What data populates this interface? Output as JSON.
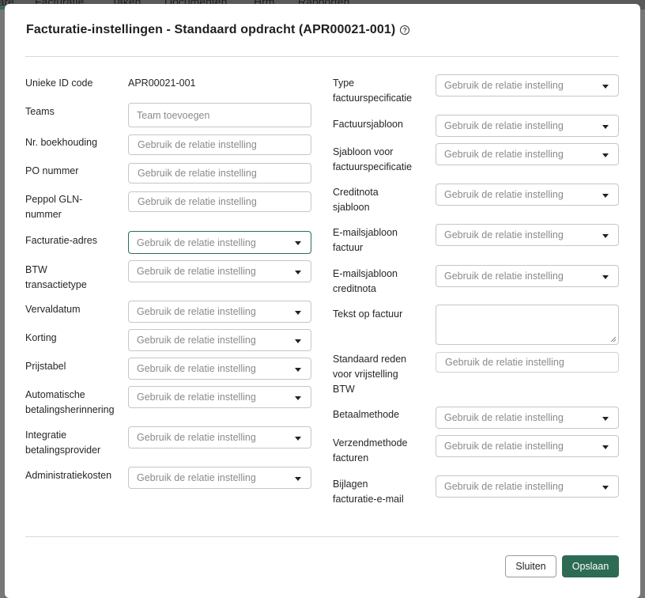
{
  "background": {
    "nav_items": [
      "...are",
      "Facturatie",
      "Taken",
      "Documenten",
      "Hrm",
      "Rapporten"
    ]
  },
  "modal": {
    "title": "Facturatie-instellingen - Standaard opdracht (APR00021-001)",
    "help_icon": "help-circle-icon"
  },
  "left": {
    "unique_id": {
      "label": "Unieke ID code",
      "value": "APR00021-001"
    },
    "teams": {
      "label": "Teams",
      "placeholder": "Team toevoegen"
    },
    "accounting_nr": {
      "label": "Nr. boekhouding",
      "placeholder": "Gebruik de relatie instelling"
    },
    "po_number": {
      "label": "PO nummer",
      "placeholder": "Gebruik de relatie instelling"
    },
    "peppol": {
      "label1": "Peppol GLN-",
      "label2": "nummer",
      "placeholder": "Gebruik de relatie instelling"
    },
    "invoice_address": {
      "label": "Facturatie-adres",
      "value": "Gebruik de relatie instelling"
    },
    "vat_type": {
      "label1": "BTW",
      "label2": "transactietype",
      "value": "Gebruik de relatie instelling"
    },
    "due_date": {
      "label": "Vervaldatum",
      "value": "Gebruik de relatie instelling"
    },
    "discount": {
      "label": "Korting",
      "value": "Gebruik de relatie instelling"
    },
    "price_table": {
      "label": "Prijstabel",
      "value": "Gebruik de relatie instelling"
    },
    "auto_reminder": {
      "label1": "Automatische",
      "label2": "betalingsherinnering",
      "value": "Gebruik de relatie instelling"
    },
    "payment_provider": {
      "label1": "Integratie",
      "label2": "betalingsprovider",
      "value": "Gebruik de relatie instelling"
    },
    "admin_costs": {
      "label": "Administratiekosten",
      "value": "Gebruik de relatie instelling"
    }
  },
  "right": {
    "spec_type": {
      "label1": "Type",
      "label2": "factuurspecificatie",
      "value": "Gebruik de relatie instelling"
    },
    "invoice_template": {
      "label": "Factuursjabloon",
      "value": "Gebruik de relatie instelling"
    },
    "spec_template": {
      "label1": "Sjabloon voor",
      "label2": "factuurspecificatie",
      "value": "Gebruik de relatie instelling"
    },
    "credit_template": {
      "label1": "Creditnota",
      "label2": "sjabloon",
      "value": "Gebruik de relatie instelling"
    },
    "email_invoice": {
      "label1": "E-mailsjabloon",
      "label2": "factuur",
      "value": "Gebruik de relatie instelling"
    },
    "email_credit": {
      "label1": "E-mailsjabloon",
      "label2": "creditnota",
      "value": "Gebruik de relatie instelling"
    },
    "invoice_text": {
      "label": "Tekst op factuur",
      "value": ""
    },
    "vat_exemption": {
      "label1": "Standaard reden",
      "label2": "voor vrijstelling",
      "label3": "BTW",
      "placeholder": "Gebruik de relatie instelling"
    },
    "payment_method": {
      "label": "Betaalmethode",
      "value": "Gebruik de relatie instelling"
    },
    "send_method": {
      "label1": "Verzendmethode",
      "label2": "facturen",
      "value": "Gebruik de relatie instelling"
    },
    "attachments": {
      "label1": "Bijlagen",
      "label2": "facturatie-e-mail",
      "value": "Gebruik de relatie instelling"
    }
  },
  "footer": {
    "close_label": "Sluiten",
    "save_label": "Opslaan"
  },
  "colors": {
    "primary": "#2d6b54",
    "focus_border": "#2a6f56",
    "overlay": "#6e6e6e"
  }
}
